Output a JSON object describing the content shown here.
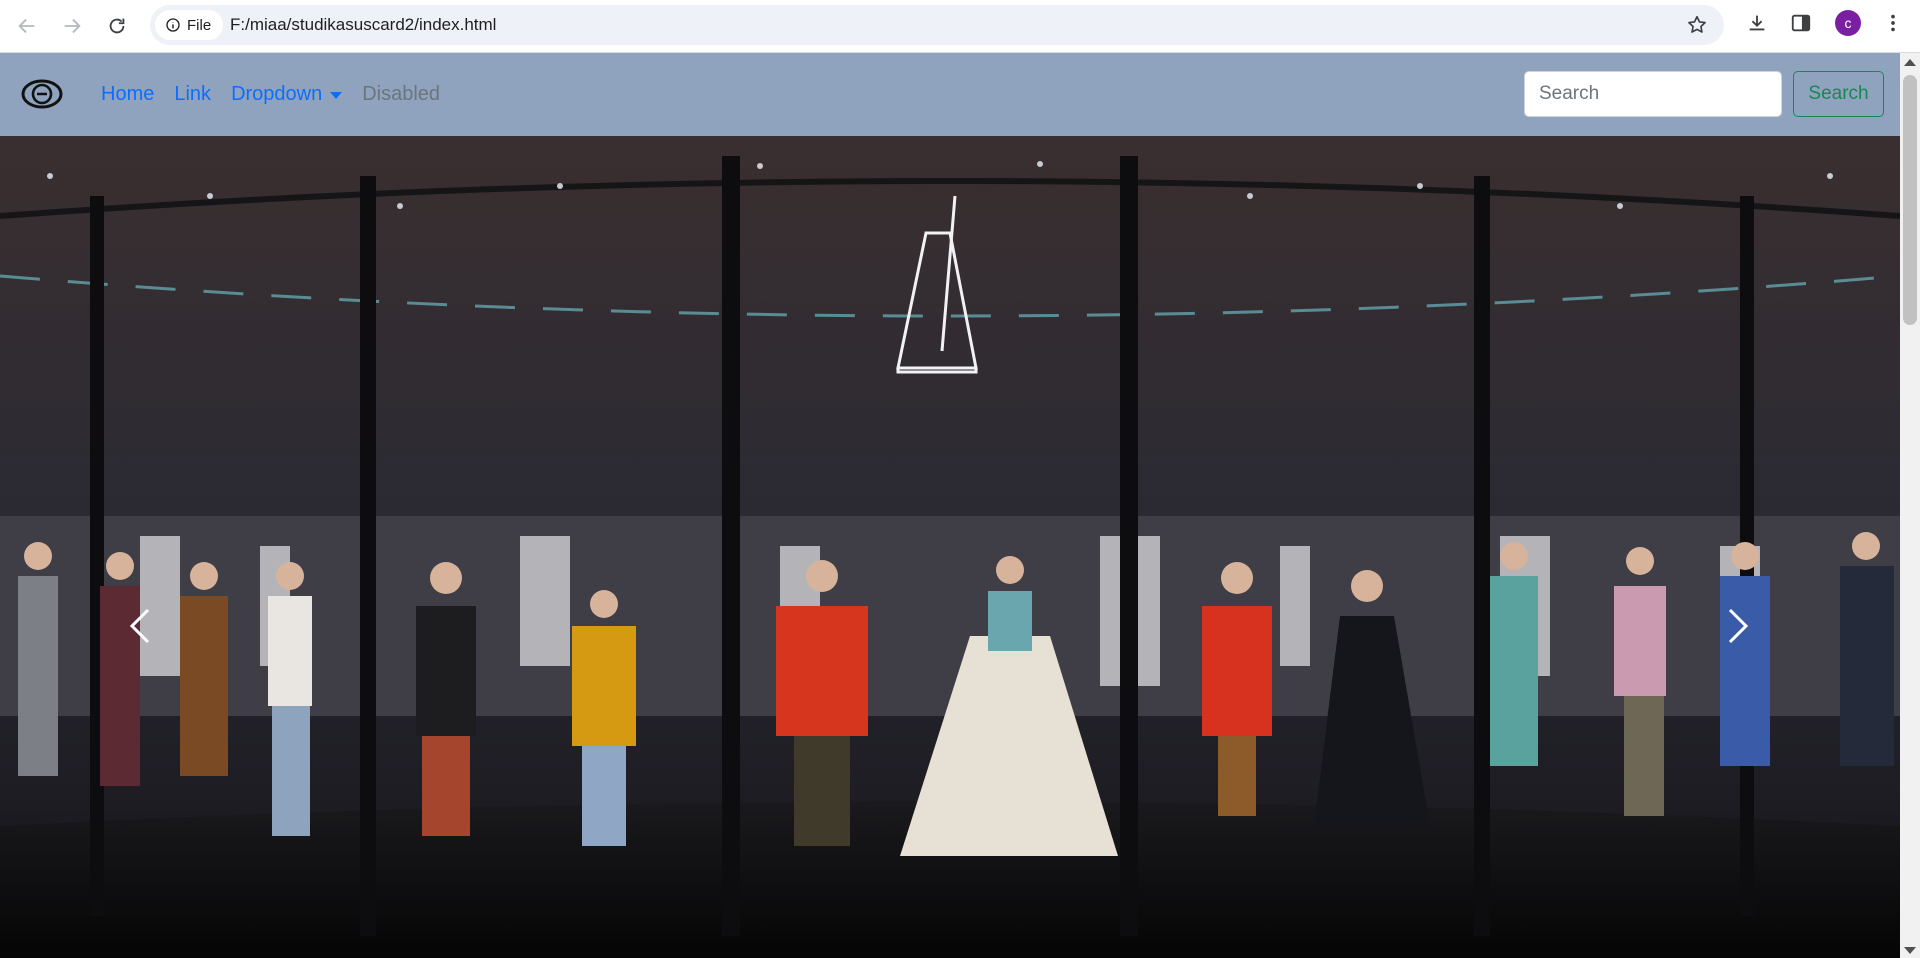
{
  "browser": {
    "back_icon": "arrow-left-icon",
    "forward_icon": "arrow-right-icon",
    "reload_icon": "reload-icon",
    "site_info_label": "File",
    "url": "F:/miaa/studikasuscard2/index.html",
    "bookmark_icon": "star-icon",
    "download_icon": "download-icon",
    "side_panel_icon": "side-panel-icon",
    "profile_initial": "c",
    "menu_icon": "kebab-menu-icon"
  },
  "navbar": {
    "brand_icon": "gucci-logo-icon",
    "links": [
      {
        "label": "Home"
      },
      {
        "label": "Link"
      },
      {
        "label": "Dropdown"
      },
      {
        "label": "Disabled"
      }
    ],
    "search_placeholder": "Search",
    "search_button": "Search",
    "background": "#8fa3be",
    "link_color": "#0d6efd",
    "disabled_color": "#6c757d",
    "button_color": "#198754"
  },
  "carousel": {
    "image_alt": "Fashion runway models standing inside a glass display",
    "prev_icon": "chevron-left-icon",
    "next_icon": "chevron-right-icon"
  }
}
